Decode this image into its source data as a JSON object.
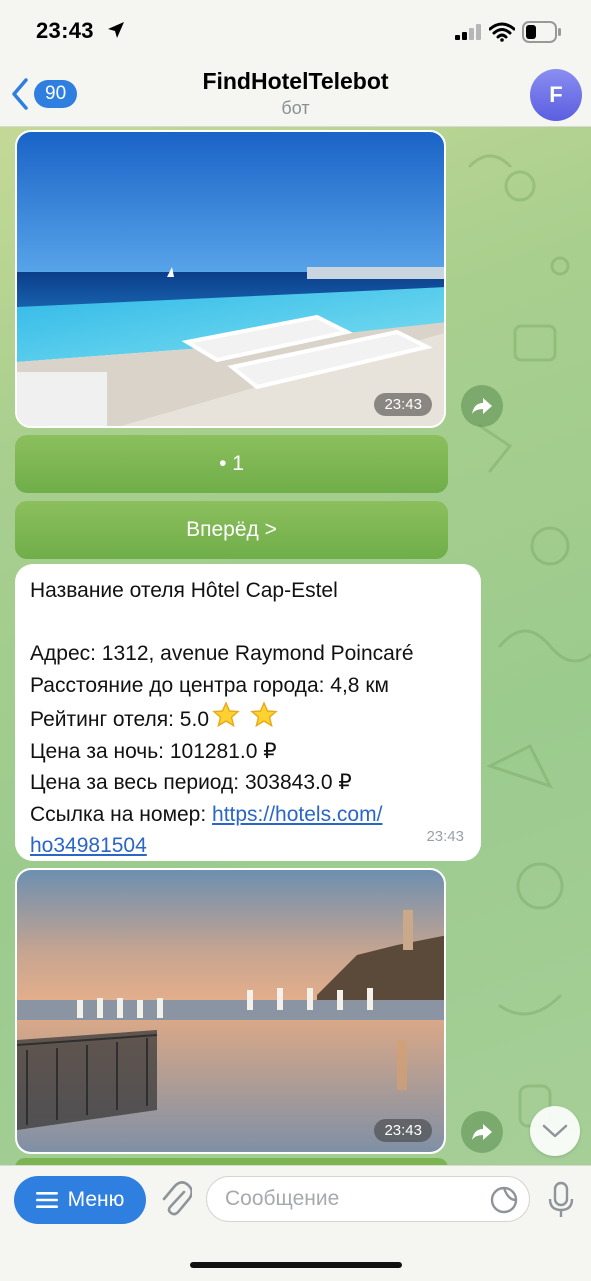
{
  "status_bar": {
    "time": "23:43"
  },
  "header": {
    "back_badge": "90",
    "title": "FindHotelTelebot",
    "subtitle": "бот",
    "avatar_letter": "F"
  },
  "messages": {
    "photo1_time": "23:43",
    "page_button": "• 1",
    "next_button": "Вперёд >",
    "hotel": {
      "line_name": "Название отеля Hôtel Cap-Estel",
      "line_address": "Адрес: 1312, avenue Raymond Poincaré",
      "line_distance": "Расстояние до центра города: 4,8 км",
      "line_rating": "Рейтинг отеля: 5.0",
      "line_price_night": "Цена за ночь: 101281.0 ₽",
      "line_price_total": "Цена за весь период: 303843.0 ₽",
      "link_label": "Ссылка на номер: ",
      "link_part1": "https://hotels.com/",
      "link_part2": "ho34981504",
      "time": "23:43"
    },
    "photo2_time": "23:43"
  },
  "input_bar": {
    "menu_label": "Меню",
    "placeholder": "Сообщение"
  },
  "colors": {
    "accent": "#2f7fe0",
    "inline_button": "#7db452",
    "link": "#2a66c8"
  },
  "icons": [
    "location-arrow-icon",
    "signal-icon",
    "wifi-icon",
    "battery-icon",
    "back-chevron-icon",
    "share-icon",
    "chevron-down-icon",
    "burger-icon",
    "paperclip-icon",
    "sticker-icon",
    "microphone-icon",
    "star-icon"
  ]
}
